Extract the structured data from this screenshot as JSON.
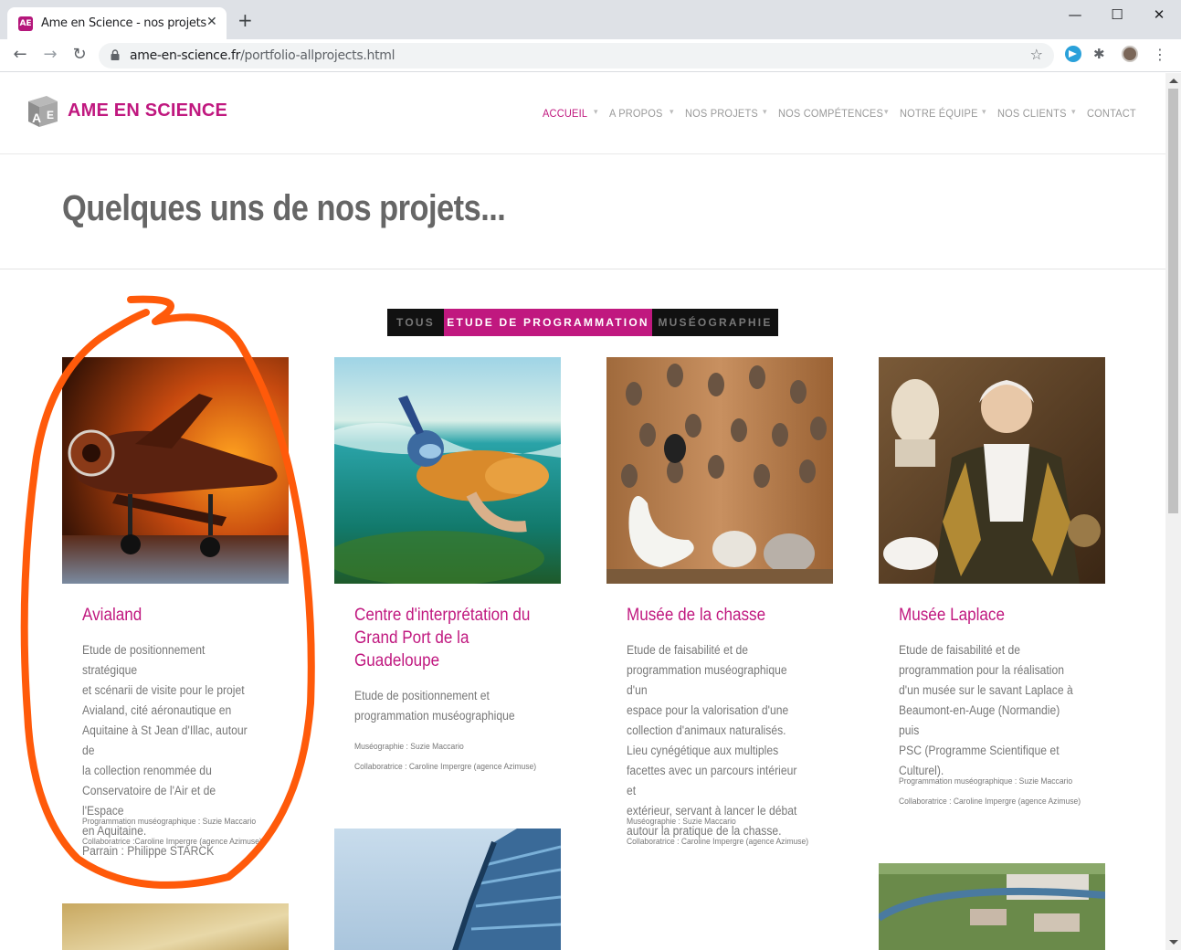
{
  "browser": {
    "tab_title": "Ame en Science - nos projets",
    "tab_favicon_text": "AE",
    "close_glyph": "✕",
    "new_tab_glyph": "+",
    "minimize_glyph": "—",
    "maximize_glyph": "☐",
    "window_close_glyph": "✕",
    "back_glyph": "←",
    "forward_glyph": "→",
    "reload_glyph": "↻",
    "url_host": "ame-en-science.fr",
    "url_path": "/portfolio-allprojects.html",
    "star_glyph": "☆",
    "puzzle_glyph": "✱",
    "menu_glyph": "⋮"
  },
  "site": {
    "logo_text": "AME EN SCIENCE",
    "brand_color": "#c0187f",
    "nav": [
      "ACCUEIL",
      "A PROPOS",
      "NOS PROJETS",
      "NOS COMPÉTENCES",
      "NOTRE ÉQUIPE",
      "NOS CLIENTS",
      "CONTACT"
    ],
    "nav_active": "ACCUEIL",
    "nav_separator": "▾"
  },
  "page": {
    "title": "Quelques uns de nos projets..."
  },
  "filters": {
    "items": [
      "TOUS",
      "ETUDE DE PROGRAMMATION",
      "MUSÉOGRAPHIE"
    ],
    "active": "ETUDE DE PROGRAMMATION"
  },
  "projects": [
    {
      "title": "Avialand",
      "description": "Etude de positionnement stratégique\net scénarii de visite pour le projet\nAvialand, cité aéronautique en\nAquitaine à St Jean d'Illac, autour de\nla collection renommée du\nConservatoire de l'Air et de l'Espace\nen Aquitaine.\nParrain : Philippe STARCK",
      "credits": "Programmation muséographique : Suzie Maccario\nCollaboratrice :Caroline Impergre (agence Azimuse)",
      "image": "jet-aircraft-hangar"
    },
    {
      "title": "Centre d'interprétation du Grand Port de la Guadeloupe",
      "description": "Etude de positionnement et\nprogrammation muséographique",
      "credits": "Muséographie : Suzie Maccario\nCollaboratrice : Caroline Impergre (agence Azimuse)",
      "image": "snorkeler-underwater"
    },
    {
      "title": "Musée de la chasse",
      "description": "Etude de faisabilité et de\nprogrammation muséographique d'un\nespace pour la valorisation d'une\ncollection d'animaux naturalisés.\nLieu cynégétique aux multiples\nfacettes avec un parcours intérieur et\nextérieur, servant à lancer le débat\nautour la pratique de la chasse.",
      "credits": "Muséographie : Suzie Maccario\nCollaboratrice : Caroline Impergre (agence Azimuse)",
      "image": "hunting-trophies-swan"
    },
    {
      "title": "Musée Laplace",
      "description": "Etude de faisabilité et de\nprogrammation pour la réalisation\nd'un musée sur le savant Laplace à\nBeaumont-en-Auge (Normandie) puis\nPSC (Programme Scientifique et\nCulturel).",
      "credits": "Programmation muséographique : Suzie Maccario\nCollaboratrice : Caroline Impergre (agence Azimuse)",
      "image": "laplace-portrait"
    }
  ],
  "annotation_color": "#ff5a0a"
}
